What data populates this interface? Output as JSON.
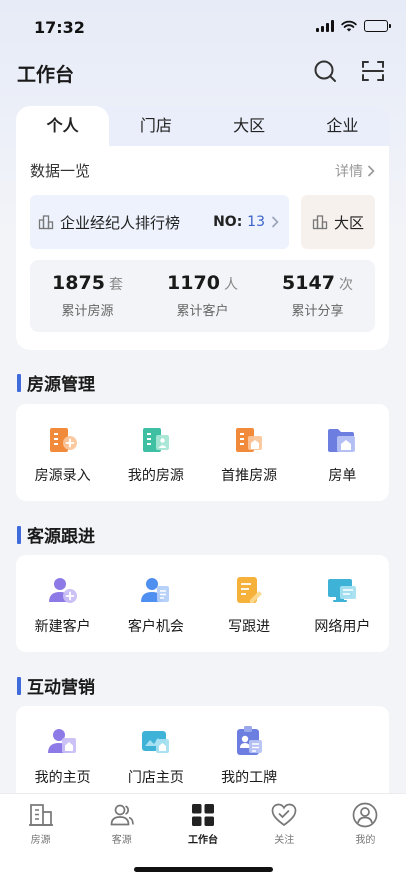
{
  "status_bar": {
    "time": "17:32"
  },
  "header": {
    "title": "工作台"
  },
  "tabs": [
    {
      "label": "个人",
      "active": true
    },
    {
      "label": "门店",
      "active": false
    },
    {
      "label": "大区",
      "active": false
    },
    {
      "label": "企业",
      "active": false
    }
  ],
  "overview": {
    "title": "数据一览",
    "detail_label": "详情",
    "ranking": {
      "label": "企业经纪人排行榜",
      "no_label": "NO:",
      "no_value": "13"
    },
    "region": {
      "label": "大区"
    },
    "stats": [
      {
        "value": "1875",
        "unit": "套",
        "caption": "累计房源"
      },
      {
        "value": "1170",
        "unit": "人",
        "caption": "累计客户"
      },
      {
        "value": "5147",
        "unit": "次",
        "caption": "累计分享"
      }
    ]
  },
  "sections": [
    {
      "title": "房源管理",
      "items": [
        {
          "label": "房源录入",
          "icon": "house-entry-icon"
        },
        {
          "label": "我的房源",
          "icon": "my-listings-icon"
        },
        {
          "label": "首推房源",
          "icon": "featured-listings-icon"
        },
        {
          "label": "房单",
          "icon": "house-list-icon"
        }
      ]
    },
    {
      "title": "客源跟进",
      "items": [
        {
          "label": "新建客户",
          "icon": "add-customer-icon"
        },
        {
          "label": "客户机会",
          "icon": "customer-opportunity-icon"
        },
        {
          "label": "写跟进",
          "icon": "write-followup-icon"
        },
        {
          "label": "网络用户",
          "icon": "network-user-icon"
        }
      ]
    },
    {
      "title": "互动营销",
      "items": [
        {
          "label": "我的主页",
          "icon": "my-homepage-icon"
        },
        {
          "label": "门店主页",
          "icon": "store-homepage-icon"
        },
        {
          "label": "我的工牌",
          "icon": "badge-icon"
        }
      ]
    }
  ],
  "tabbar": [
    {
      "label": "房源",
      "icon": "building-icon",
      "active": false
    },
    {
      "label": "客源",
      "icon": "people-icon",
      "active": false
    },
    {
      "label": "工作台",
      "icon": "grid-icon",
      "active": true
    },
    {
      "label": "关注",
      "icon": "heart-icon",
      "active": false
    },
    {
      "label": "我的",
      "icon": "profile-icon",
      "active": false
    }
  ],
  "colors": {
    "accent": "#3f6bdb",
    "rank_number": "#3a64c9",
    "orange": "#f28a3c",
    "teal": "#3fc0a2",
    "purple": "#8d7ae6",
    "blue": "#4f8ff0"
  }
}
